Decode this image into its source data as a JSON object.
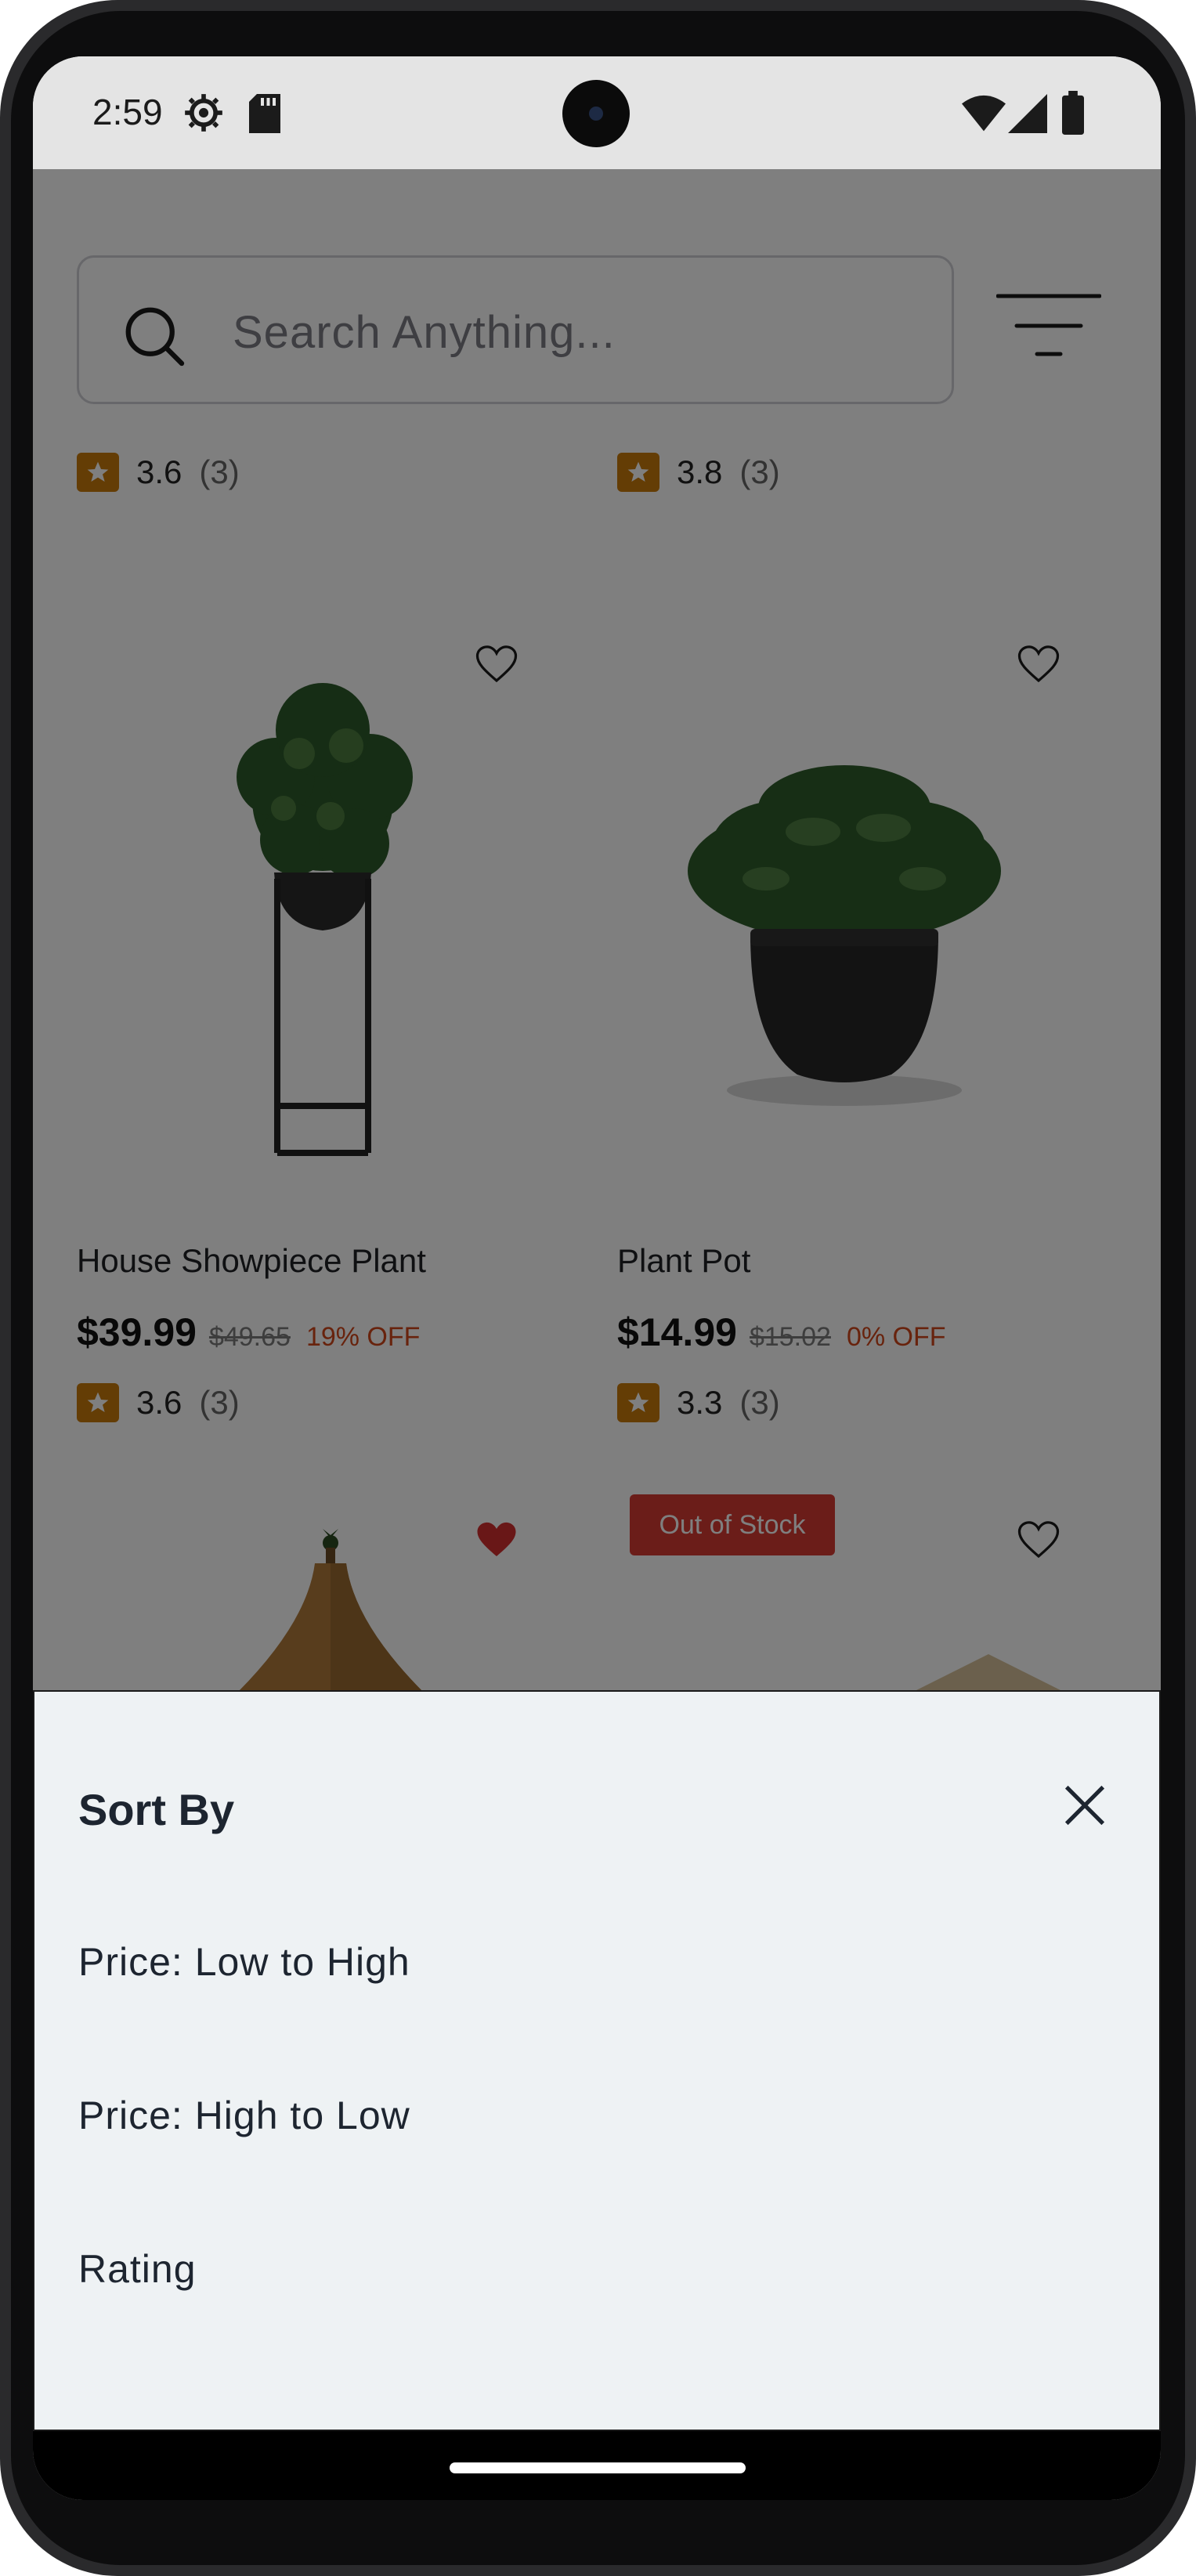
{
  "status_bar": {
    "time": "2:59"
  },
  "search": {
    "placeholder": "Search Anything..."
  },
  "top_ratings": [
    {
      "rating": "3.6",
      "count": "(3)"
    },
    {
      "rating": "3.8",
      "count": "(3)"
    }
  ],
  "products": [
    {
      "name": "House Showpiece Plant",
      "price": "$39.99",
      "original_price": "$49.65",
      "discount": "19% OFF",
      "rating": "3.6",
      "count": "(3)",
      "favorited": false
    },
    {
      "name": "Plant Pot",
      "price": "$14.99",
      "original_price": "$15.02",
      "discount": "0% OFF",
      "rating": "3.3",
      "count": "(3)",
      "favorited": false
    }
  ],
  "next_row": [
    {
      "favorited": true,
      "badge": ""
    },
    {
      "favorited": false,
      "badge": "Out of Stock"
    }
  ],
  "sort_sheet": {
    "title": "Sort By",
    "options": [
      "Price: Low to High",
      "Price: High to Low",
      "Rating"
    ]
  },
  "colors": {
    "star": "#c97a0a",
    "discount": "#d0471b",
    "favorite": "#d32f2f",
    "badge": "#d63a33",
    "sheet_bg": "#eef2f4"
  }
}
